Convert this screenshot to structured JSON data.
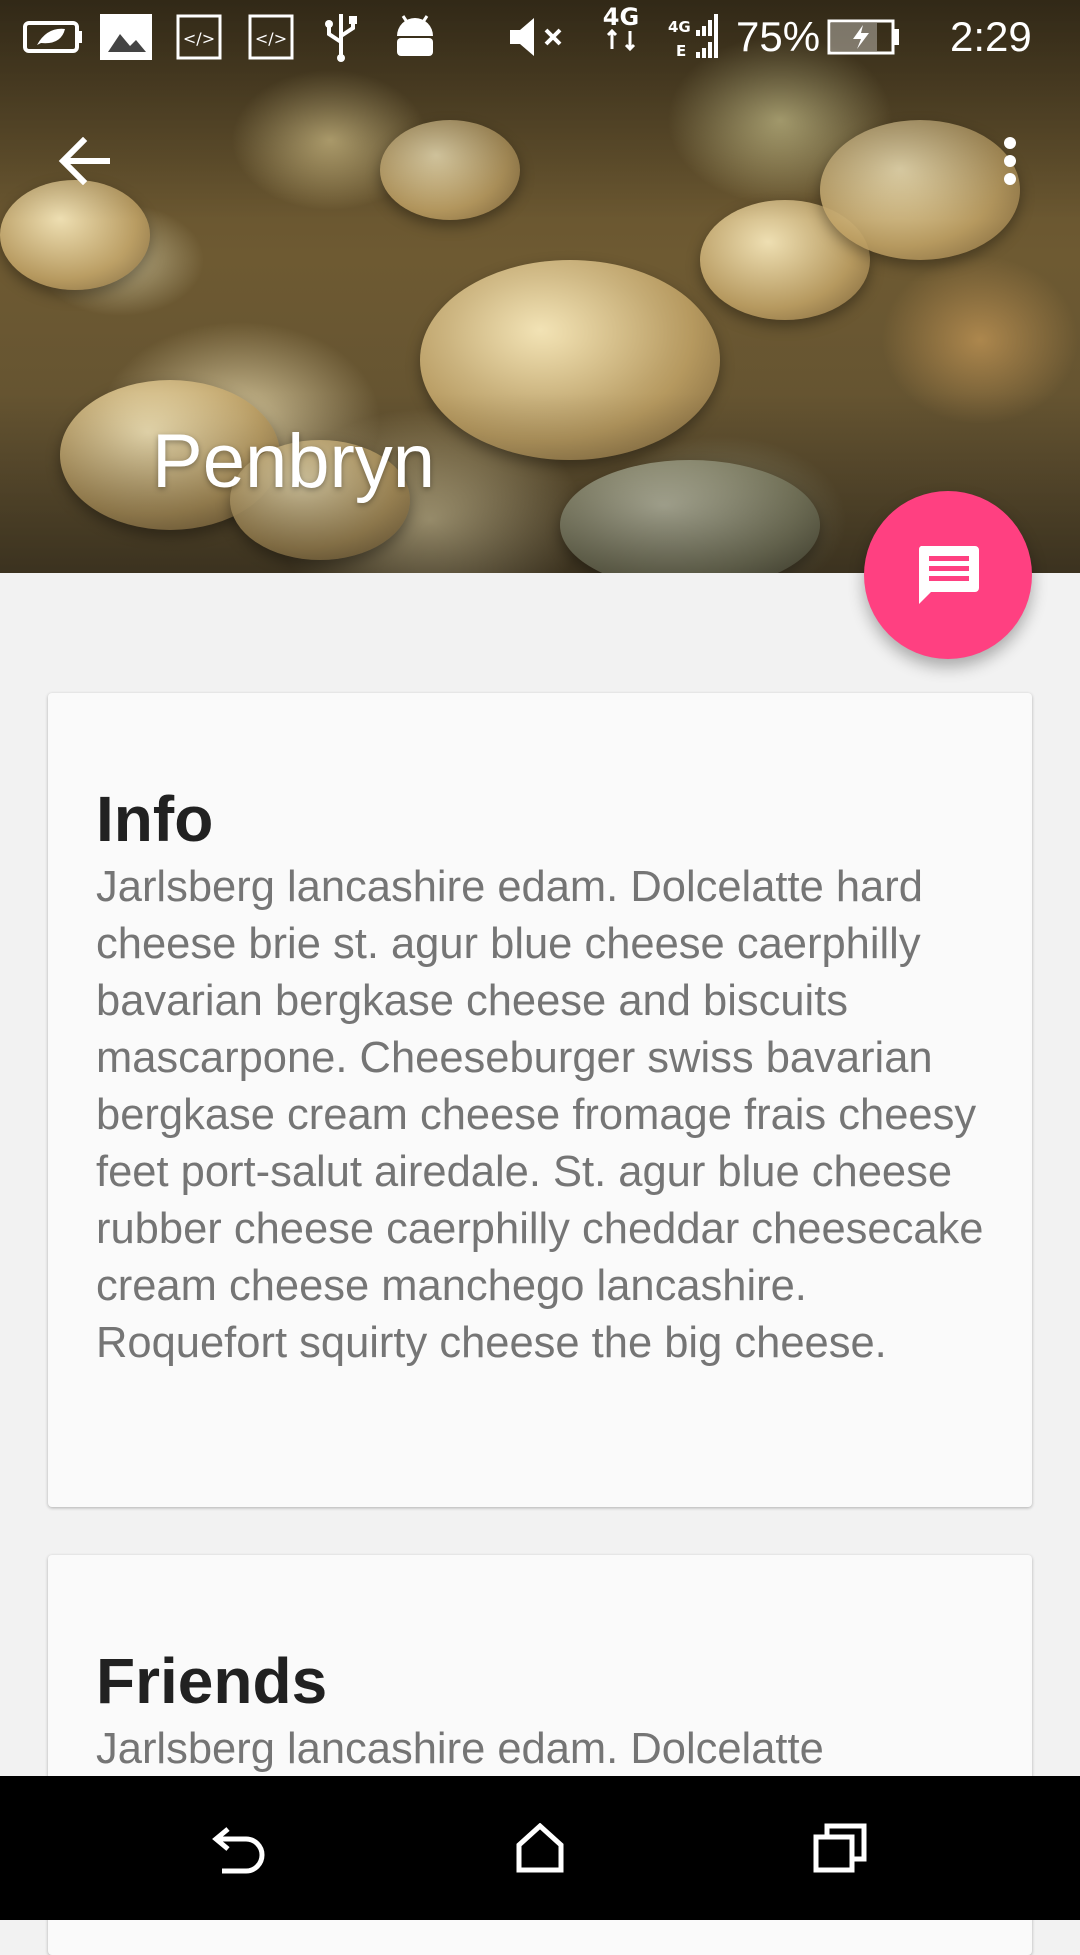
{
  "status_bar": {
    "battery_percent": "75%",
    "time": "2:29",
    "network_label": "4G",
    "icons": [
      "eco-battery-icon",
      "photo-notification-icon",
      "code-notification-icon",
      "code-notification-icon",
      "usb-icon",
      "android-debug-icon",
      "volume-muted-icon",
      "data-4g-icon",
      "signal-icon",
      "battery-charging-icon"
    ]
  },
  "toolbar": {
    "title": "Penbryn",
    "back_icon": "arrow-back-icon",
    "overflow_icon": "more-vert-icon"
  },
  "fab": {
    "icon": "message-icon",
    "color": "#ff4081"
  },
  "cards": [
    {
      "title": "Info",
      "body": "Jarlsberg lancashire edam. Dolcelatte hard cheese brie st. agur blue cheese caerphilly bavarian bergkase cheese and biscuits mascarpone. Cheeseburger swiss bavarian bergkase cream cheese fromage frais cheesy feet port-salut airedale. St. agur blue cheese rubber cheese caerphilly cheddar cheesecake cream cheese manchego lancashire. Roquefort squirty cheese the big cheese."
    },
    {
      "title": "Friends",
      "body": "Jarlsberg lancashire edam. Dolcelatte"
    }
  ],
  "nav_bar": {
    "icons": [
      "back-nav-icon",
      "home-nav-icon",
      "recents-nav-icon"
    ]
  },
  "colors": {
    "accent": "#ff4081",
    "background": "#f2f2f2",
    "card": "#fafafa",
    "title_text": "#212121",
    "body_text": "#757575"
  }
}
